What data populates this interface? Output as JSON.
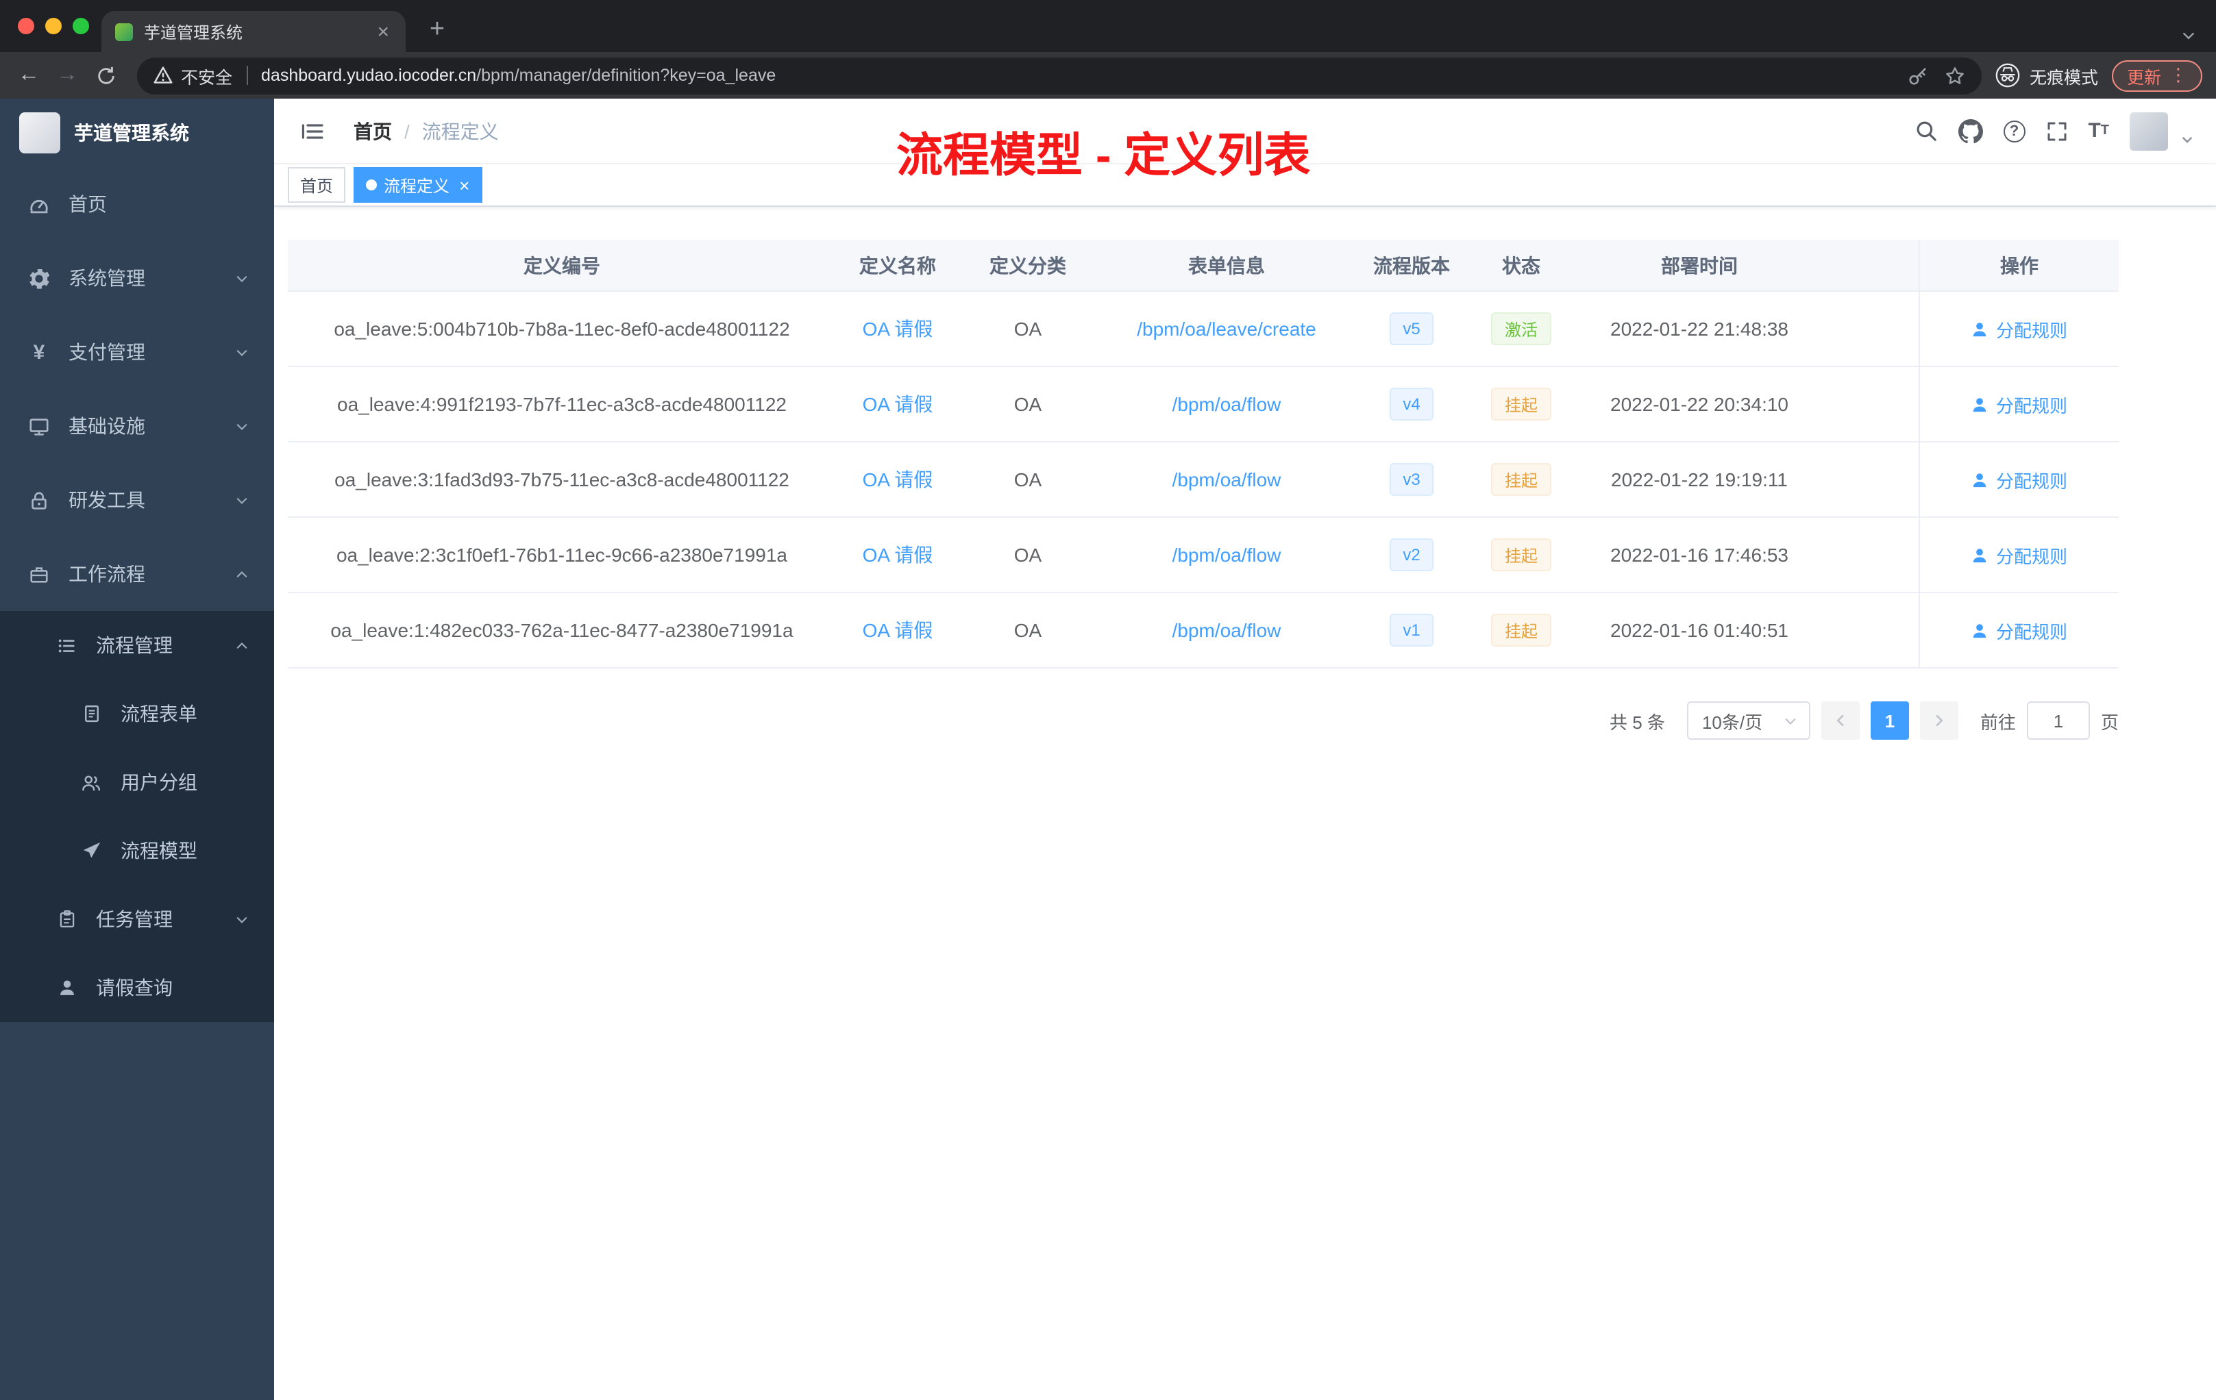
{
  "browser": {
    "tab_title": "芋道管理系统",
    "new_tab": "+",
    "security_label": "不安全",
    "url_domain": "dashboard.yudao.iocoder.cn",
    "url_path": "/bpm/manager/definition?key=oa_leave",
    "incognito_label": "无痕模式",
    "update_label": "更新"
  },
  "sidebar": {
    "logo_title": "芋道管理系统",
    "items": [
      {
        "label": "首页"
      },
      {
        "label": "系统管理"
      },
      {
        "label": "支付管理"
      },
      {
        "label": "基础设施"
      },
      {
        "label": "研发工具"
      },
      {
        "label": "工作流程"
      },
      {
        "label": "流程管理"
      },
      {
        "label": "流程表单"
      },
      {
        "label": "用户分组"
      },
      {
        "label": "流程模型"
      },
      {
        "label": "任务管理"
      },
      {
        "label": "请假查询"
      }
    ]
  },
  "header": {
    "breadcrumb_home": "首页",
    "breadcrumb_separator": "/",
    "breadcrumb_current": "流程定义",
    "annotation": "流程模型 - 定义列表"
  },
  "tags": {
    "home": "首页",
    "active": "流程定义",
    "close": "×"
  },
  "table": {
    "columns": [
      "定义编号",
      "定义名称",
      "定义分类",
      "表单信息",
      "流程版本",
      "状态",
      "部署时间",
      "操作"
    ],
    "rows": [
      {
        "id": "oa_leave:5:004b710b-7b8a-11ec-8ef0-acde48001122",
        "name": "OA 请假",
        "category": "OA",
        "form": "/bpm/oa/leave/create",
        "version": "v5",
        "status": "激活",
        "time": "2022-01-22 21:48:38",
        "action": "分配规则"
      },
      {
        "id": "oa_leave:4:991f2193-7b7f-11ec-a3c8-acde48001122",
        "name": "OA 请假",
        "category": "OA",
        "form": "/bpm/oa/flow",
        "version": "v4",
        "status": "挂起",
        "time": "2022-01-22 20:34:10",
        "action": "分配规则"
      },
      {
        "id": "oa_leave:3:1fad3d93-7b75-11ec-a3c8-acde48001122",
        "name": "OA 请假",
        "category": "OA",
        "form": "/bpm/oa/flow",
        "version": "v3",
        "status": "挂起",
        "time": "2022-01-22 19:19:11",
        "action": "分配规则"
      },
      {
        "id": "oa_leave:2:3c1f0ef1-76b1-11ec-9c66-a2380e71991a",
        "name": "OA 请假",
        "category": "OA",
        "form": "/bpm/oa/flow",
        "version": "v2",
        "status": "挂起",
        "time": "2022-01-16 17:46:53",
        "action": "分配规则"
      },
      {
        "id": "oa_leave:1:482ec033-762a-11ec-8477-a2380e71991a",
        "name": "OA 请假",
        "category": "OA",
        "form": "/bpm/oa/flow",
        "version": "v1",
        "status": "挂起",
        "time": "2022-01-16 01:40:51",
        "action": "分配规则"
      }
    ]
  },
  "pagination": {
    "total": "共 5 条",
    "page_size": "10条/页",
    "current_page": "1",
    "goto_label": "前往",
    "goto_value": "1",
    "page_unit": "页"
  },
  "colors": {
    "accent_blue": "#409eff",
    "success_green": "#67c23a",
    "warning_orange": "#e6a23c",
    "annotation_red": "#f51818",
    "sidebar_bg": "#304156",
    "submenu_bg": "#1f2d3d"
  }
}
